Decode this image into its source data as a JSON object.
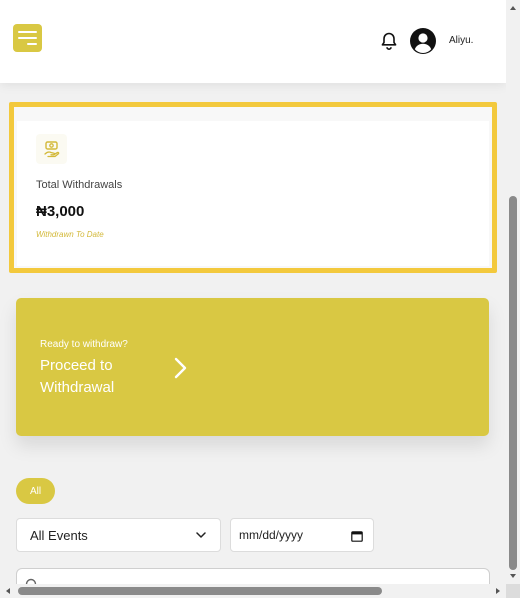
{
  "header": {
    "menu_icon": "hamburger-menu-icon",
    "bell_icon": "bell-icon",
    "avatar_icon": "user-avatar-icon",
    "username": "Aliyu."
  },
  "withdrawals_card": {
    "icon": "money-hand-icon",
    "label": "Total Withdrawals",
    "value": "₦3,000",
    "subtitle": "Withdrawn To Date"
  },
  "proceed_banner": {
    "kicker": "Ready to withdraw?",
    "title": "Proceed to Withdrawal",
    "chevron_icon": "chevron-right-icon"
  },
  "filters": {
    "pill_all": "All",
    "event_select": "All Events",
    "date_placeholder": "mm/dd/yyyy"
  },
  "colors": {
    "accent": "#d9c843",
    "card_border": "#f3c93d",
    "subtitle": "#d3b93a"
  }
}
